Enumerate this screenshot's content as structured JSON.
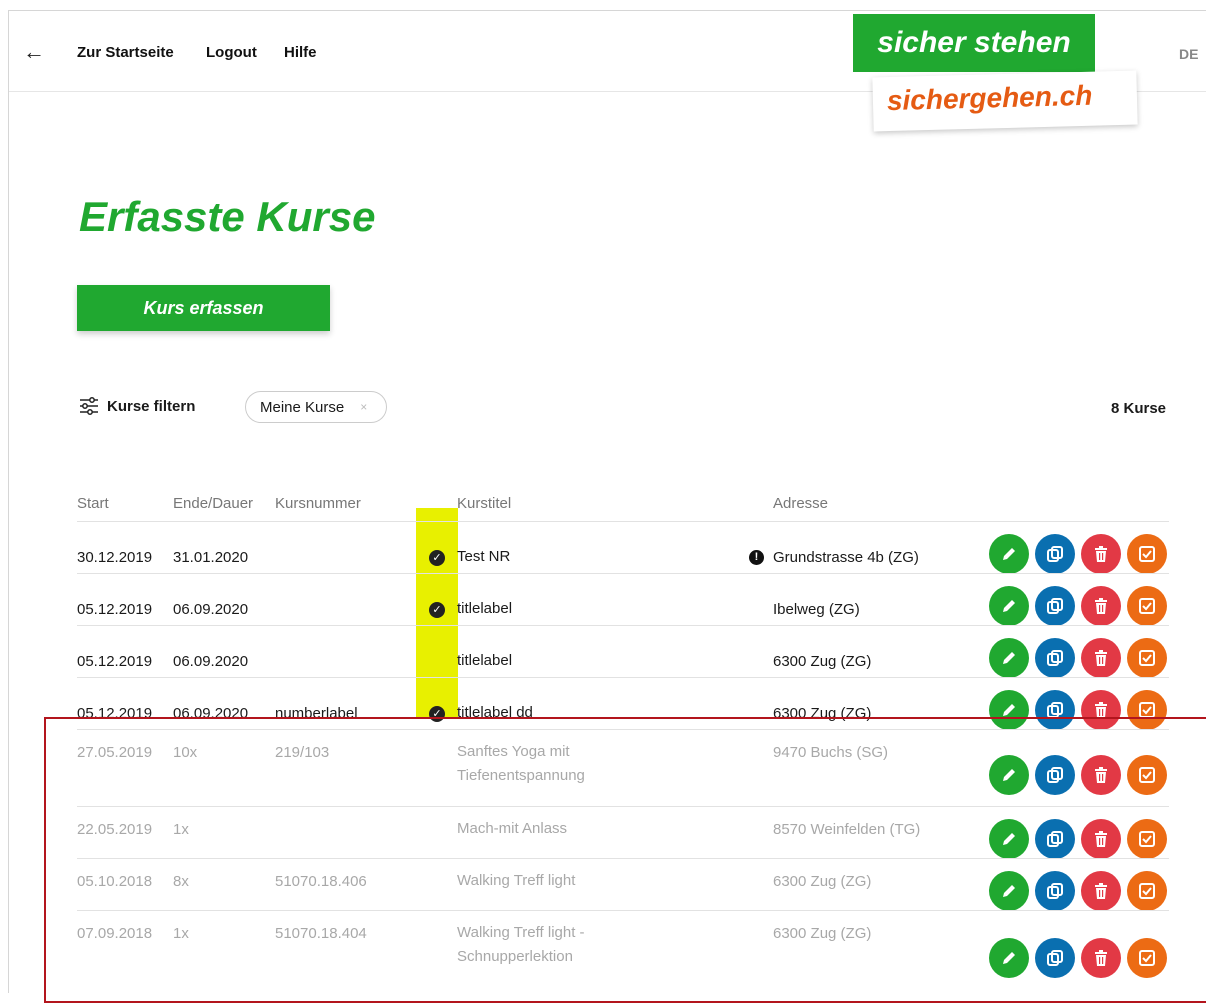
{
  "nav": {
    "back_symbol": "←",
    "links": [
      "Zur Startseite",
      "Logout",
      "Hilfe"
    ],
    "lang": "DE"
  },
  "logo": {
    "line1": "sicher stehen",
    "line2a": "sicher",
    "line2b": "gehen.ch"
  },
  "page_title": "Erfasste Kurse",
  "create_button": "Kurs erfassen",
  "filter": {
    "label": "Kurse filtern",
    "chip": "Meine Kurse",
    "chip_close": "×"
  },
  "count_label": "8 Kurse",
  "table": {
    "headers": [
      "Start",
      "Ende/Dauer",
      "Kursnummer",
      "Kurstitel",
      "Adresse"
    ],
    "rows": [
      {
        "start": "30.12.2019",
        "ende": "31.01.2020",
        "nummer": "",
        "titel": [
          "Test NR"
        ],
        "adresse": "Grundstrasse 4b (ZG)",
        "check": true,
        "warn": true,
        "dim": false
      },
      {
        "start": "05.12.2019",
        "ende": "06.09.2020",
        "nummer": "",
        "titel": [
          "titlelabel"
        ],
        "adresse": "Ibelweg (ZG)",
        "check": true,
        "warn": false,
        "dim": false
      },
      {
        "start": "05.12.2019",
        "ende": "06.09.2020",
        "nummer": "",
        "titel": [
          "titlelabel"
        ],
        "adresse": "6300 Zug (ZG)",
        "check": false,
        "warn": false,
        "dim": false
      },
      {
        "start": "05.12.2019",
        "ende": "06.09.2020",
        "nummer": "numberlabel",
        "titel": [
          "titlelabel dd"
        ],
        "adresse": "6300 Zug (ZG)",
        "check": true,
        "warn": false,
        "dim": false
      },
      {
        "start": "27.05.2019",
        "ende": "10x",
        "nummer": "219/103",
        "titel": [
          "Sanftes Yoga mit",
          "Tiefenentspannung"
        ],
        "adresse": "9470 Buchs (SG)",
        "check": false,
        "warn": false,
        "dim": true
      },
      {
        "start": "22.05.2019",
        "ende": "1x",
        "nummer": "",
        "titel": [
          "Mach-mit Anlass"
        ],
        "adresse": "8570 Weinfelden (TG)",
        "check": false,
        "warn": false,
        "dim": true
      },
      {
        "start": "05.10.2018",
        "ende": "8x",
        "nummer": "51070.18.406",
        "titel": [
          "Walking Treff light"
        ],
        "adresse": "6300 Zug (ZG)",
        "check": false,
        "warn": false,
        "dim": true
      },
      {
        "start": "07.09.2018",
        "ende": "1x",
        "nummer": "51070.18.404",
        "titel": [
          "Walking Treff light -",
          "Schnupperlektion"
        ],
        "adresse": "6300 Zug (ZG)",
        "check": false,
        "warn": false,
        "dim": true
      }
    ]
  },
  "icons": {
    "check": "check-circle-icon",
    "warn": "exclamation-icon",
    "edit": "pencil-icon",
    "copy": "copy-icon",
    "delete": "trash-icon",
    "done": "checkbox-icon"
  },
  "colors": {
    "green": "#20a830",
    "blue": "#0a6fb0",
    "red": "#e23945",
    "orange": "#ec6b14",
    "highlight": "#e8f000",
    "annotation": "#b3151d"
  }
}
